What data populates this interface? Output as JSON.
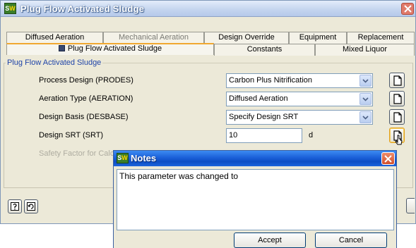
{
  "window": {
    "title": "Plug Flow Activated Sludge",
    "icon": "sw-app-icon",
    "icon_text": "S",
    "icon_text_accent": "W"
  },
  "tabs": {
    "row1": [
      "Diffused Aeration",
      "Mechanical Aeration",
      "Design Override",
      "Equipment",
      "Replacement"
    ],
    "row2": [
      "Plug Flow Activated Sludge",
      "Constants",
      "Mixed Liquor"
    ],
    "active": "Plug Flow Activated Sludge"
  },
  "group": {
    "label": "Plug Flow Activated Sludge"
  },
  "form": {
    "process_design": {
      "label": "Process Design (PRODES)",
      "value": "Carbon Plus Nitrification"
    },
    "aeration_type": {
      "label": "Aeration Type (AERATION)",
      "value": "Diffused Aeration"
    },
    "design_basis": {
      "label": "Design Basis (DESBASE)",
      "value": "Specify Design SRT"
    },
    "design_srt": {
      "label": "Design SRT (SRT)",
      "value": "10",
      "unit": "d"
    },
    "safety_factor": {
      "label": "Safety Factor for Calc"
    }
  },
  "notes_dialog": {
    "title": "Notes",
    "text": "This parameter was changed to",
    "accept_label": "Accept",
    "cancel_label": "Cancel"
  },
  "colors": {
    "active_tab_accent": "#f0a830",
    "group_label": "#1f44a8",
    "dialog_title": "#1a5fd8",
    "close_button": "#d3502c"
  }
}
